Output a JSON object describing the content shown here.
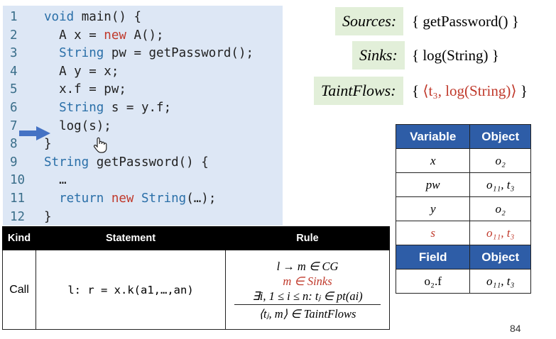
{
  "code": {
    "lines": [
      {
        "n": "1",
        "parts": [
          {
            "t": "void ",
            "c": "kw"
          },
          {
            "t": "main() {",
            "c": ""
          }
        ]
      },
      {
        "n": "2",
        "parts": [
          {
            "t": "  A x = ",
            "c": ""
          },
          {
            "t": "new",
            "c": "red"
          },
          {
            "t": " A();",
            "c": ""
          }
        ]
      },
      {
        "n": "3",
        "parts": [
          {
            "t": "  ",
            "c": ""
          },
          {
            "t": "String",
            "c": "kw"
          },
          {
            "t": " pw = getPassword();",
            "c": ""
          }
        ]
      },
      {
        "n": "4",
        "parts": [
          {
            "t": "  A y = x;",
            "c": ""
          }
        ]
      },
      {
        "n": "5",
        "parts": [
          {
            "t": "  x.f = pw;",
            "c": ""
          }
        ]
      },
      {
        "n": "6",
        "parts": [
          {
            "t": "  ",
            "c": ""
          },
          {
            "t": "String",
            "c": "kw"
          },
          {
            "t": " s = y.f;",
            "c": ""
          }
        ]
      },
      {
        "n": "7",
        "parts": [
          {
            "t": "  log(s);",
            "c": ""
          }
        ]
      },
      {
        "n": "8",
        "parts": [
          {
            "t": "}",
            "c": ""
          }
        ]
      },
      {
        "n": "9",
        "parts": [
          {
            "t": "String",
            "c": "kw"
          },
          {
            "t": " getPassword() {",
            "c": ""
          }
        ]
      },
      {
        "n": "10",
        "parts": [
          {
            "t": "  …",
            "c": ""
          }
        ]
      },
      {
        "n": "11",
        "parts": [
          {
            "t": "  ",
            "c": ""
          },
          {
            "t": "return",
            "c": "kw"
          },
          {
            "t": " ",
            "c": ""
          },
          {
            "t": "new",
            "c": "red"
          },
          {
            "t": " ",
            "c": ""
          },
          {
            "t": "String",
            "c": "kw"
          },
          {
            "t": "(…);",
            "c": ""
          }
        ]
      },
      {
        "n": "12",
        "parts": [
          {
            "t": "}",
            "c": ""
          }
        ]
      }
    ]
  },
  "sources": {
    "label": "Sources:",
    "value": "{ getPassword() }"
  },
  "sinks": {
    "label": "Sinks:",
    "value": "{ log(String) }"
  },
  "taintflows": {
    "label": "TaintFlows:",
    "open": "{ ",
    "value": "⟨t₃, log(String)⟩",
    "close": " }"
  },
  "var_table": {
    "headers": [
      "Variable",
      "Object"
    ],
    "rows": [
      [
        "x",
        "o₂"
      ],
      [
        "pw",
        "o₁₁, t₃"
      ],
      [
        "y",
        "o₂"
      ],
      [
        "s",
        "o₁₁, t₃"
      ]
    ],
    "field_headers": [
      "Field",
      "Object"
    ],
    "field_rows": [
      [
        "o₂.f",
        "o₁₁, t₃"
      ]
    ]
  },
  "rule_table": {
    "headers": [
      "Kind",
      "Statement",
      "Rule"
    ],
    "kind": "Call",
    "statement": "l: r = x.k(a1,…,an)",
    "premises": [
      "l → m ∈ CG",
      "m ∈ Sinks",
      "∃i, 1 ≤ i ≤ n: tⱼ ∈ pt(ai)"
    ],
    "conclusion": "⟨tⱼ, m⟩ ∈ TaintFlows"
  },
  "page_number": "84",
  "colors": {
    "code_bg": "#dde7f5",
    "box_bg": "#e2efd9",
    "header_blue": "#2e5da7",
    "accent_red": "#c0392b",
    "arrow_blue": "#4472c4"
  }
}
